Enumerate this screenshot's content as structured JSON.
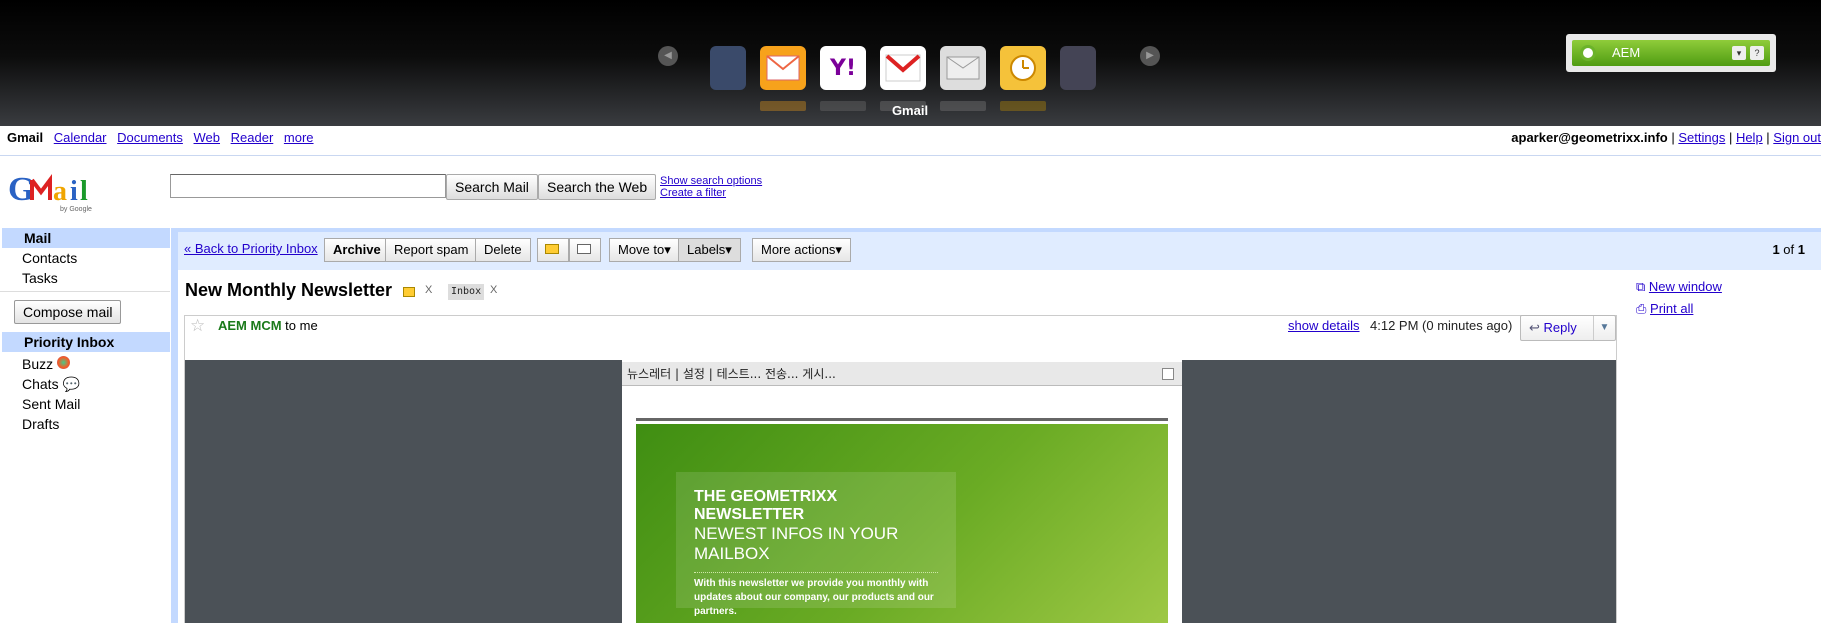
{
  "window": {
    "app_caption": "Gmail"
  },
  "aem": {
    "label": "AEM"
  },
  "gbar": {
    "links": [
      "Gmail",
      "Calendar",
      "Documents",
      "Web",
      "Reader",
      "more"
    ],
    "user": "aparker@geometrixx.info",
    "settings": "Settings",
    "help": "Help",
    "signout": "Sign out"
  },
  "search": {
    "search_mail": "Search Mail",
    "search_web": "Search the Web",
    "show_options": "Show search options",
    "create_filter": "Create a filter"
  },
  "nav": {
    "top": [
      "Mail",
      "Contacts",
      "Tasks"
    ],
    "compose": "Compose mail",
    "folders": [
      "Priority Inbox",
      "Buzz",
      "Chats",
      "Sent Mail",
      "Drafts"
    ]
  },
  "toolbar": {
    "back": "« Back to Priority Inbox",
    "archive": "Archive",
    "spam": "Report spam",
    "delete": "Delete",
    "move_to": "Move to▾",
    "labels": "Labels▾",
    "more_actions": "More actions▾",
    "page_cur": "1",
    "page_of": "of",
    "page_total": "1"
  },
  "message": {
    "subject": "New Monthly Newsletter",
    "label1": "Inbox",
    "label_x": "X",
    "sender": "AEM MCM",
    "to": "to me",
    "show_details": "show details",
    "time": "4:12 PM (0 minutes ago)",
    "reply": "Reply"
  },
  "side_links": {
    "new_window": "New window",
    "print_all": "Print all"
  },
  "newsletter": {
    "bar": "뉴스레터 | 설정 | 테스트... 전송... 게시...",
    "title": "THE GEOMETRIXX NEWSLETTER",
    "subtitle": "NEWEST INFOS IN YOUR MAILBOX",
    "body": "With this newsletter we provide you monthly with updates about our company, our products and our partners."
  },
  "colors": {
    "gmail_blue": "#c3d9ff",
    "link": "#2200cc",
    "newsletter_green": "#6aab24"
  }
}
